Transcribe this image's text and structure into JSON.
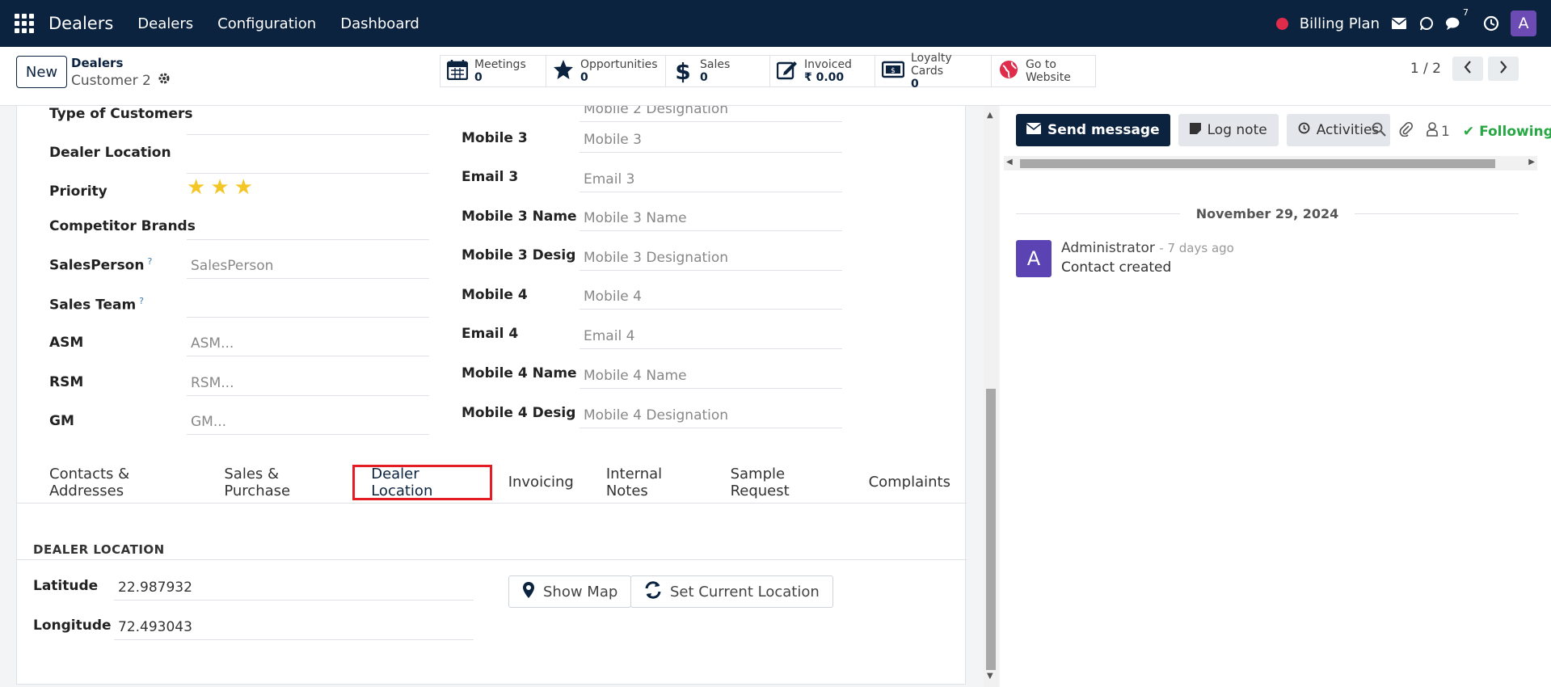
{
  "navbar": {
    "brand": "Dealers",
    "menu": [
      "Dealers",
      "Configuration",
      "Dashboard"
    ],
    "billing": "Billing Plan",
    "chat_badge": "7",
    "avatar_letter": "A"
  },
  "control": {
    "new_label": "New",
    "breadcrumb_parent": "Dealers",
    "breadcrumb_current": "Customer 2",
    "smart_buttons": [
      {
        "label": "Meetings",
        "value": "0",
        "icon": "calendar-icon"
      },
      {
        "label": "Opportunities",
        "value": "0",
        "icon": "star-icon"
      },
      {
        "label": "Sales",
        "value": "0",
        "icon": "dollar-icon"
      },
      {
        "label": "Invoiced",
        "value": "₹ 0.00",
        "icon": "edit-icon"
      },
      {
        "label": "Loyalty Cards",
        "value": "0",
        "icon": "money-icon"
      },
      {
        "label": "Go to",
        "value": "Website",
        "icon": "globe-icon"
      }
    ],
    "pager": "1 / 2"
  },
  "form": {
    "left_fields": [
      {
        "label": "Type of Customers",
        "value": "",
        "placeholder": ""
      },
      {
        "label": "Dealer Location",
        "value": "",
        "placeholder": ""
      },
      {
        "label": "Priority",
        "value": "3",
        "placeholder": ""
      },
      {
        "label": "Competitor Brands",
        "value": "",
        "placeholder": ""
      },
      {
        "label": "SalesPerson",
        "value": "",
        "placeholder": "SalesPerson",
        "help": "?"
      },
      {
        "label": "Sales Team",
        "value": "",
        "placeholder": "",
        "help": "?"
      },
      {
        "label": "ASM",
        "value": "",
        "placeholder": "ASM..."
      },
      {
        "label": "RSM",
        "value": "",
        "placeholder": "RSM..."
      },
      {
        "label": "GM",
        "value": "",
        "placeholder": "GM..."
      }
    ],
    "right_cut_placeholder": "Mobile 2 Designation",
    "right_fields": [
      {
        "label": "Mobile 3",
        "placeholder": "Mobile 3"
      },
      {
        "label": "Email 3",
        "placeholder": "Email 3"
      },
      {
        "label": "Mobile 3 Name",
        "placeholder": "Mobile 3 Name"
      },
      {
        "label": "Mobile 3 Desig",
        "placeholder": "Mobile 3 Designation"
      },
      {
        "label": "Mobile 4",
        "placeholder": "Mobile 4"
      },
      {
        "label": "Email 4",
        "placeholder": "Email 4"
      },
      {
        "label": "Mobile 4 Name",
        "placeholder": "Mobile 4 Name"
      },
      {
        "label": "Mobile 4 Desig",
        "placeholder": "Mobile 4 Designation"
      }
    ],
    "tabs": [
      "Contacts & Addresses",
      "Sales & Purchase",
      "Dealer Location",
      "Invoicing",
      "Internal Notes",
      "Sample Request",
      "Complaints"
    ],
    "active_tab": "Dealer Location",
    "section_title": "DEALER LOCATION",
    "latitude_label": "Latitude",
    "latitude_value": "22.987932",
    "longitude_label": "Longitude",
    "longitude_value": "72.493043",
    "show_map": "Show Map",
    "set_location": "Set Current Location"
  },
  "chatter": {
    "send_message": "Send message",
    "log_note": "Log note",
    "activities": "Activities",
    "followers_count": "1",
    "following": "Following",
    "date": "November 29, 2024",
    "message": {
      "avatar": "A",
      "author": "Administrator",
      "time": "- 7 days ago",
      "body": "Contact created"
    }
  },
  "colors": {
    "navbar": "#0c2340",
    "active_tab_border": "#e41c24",
    "star": "#f3c623",
    "following": "#28a745"
  }
}
